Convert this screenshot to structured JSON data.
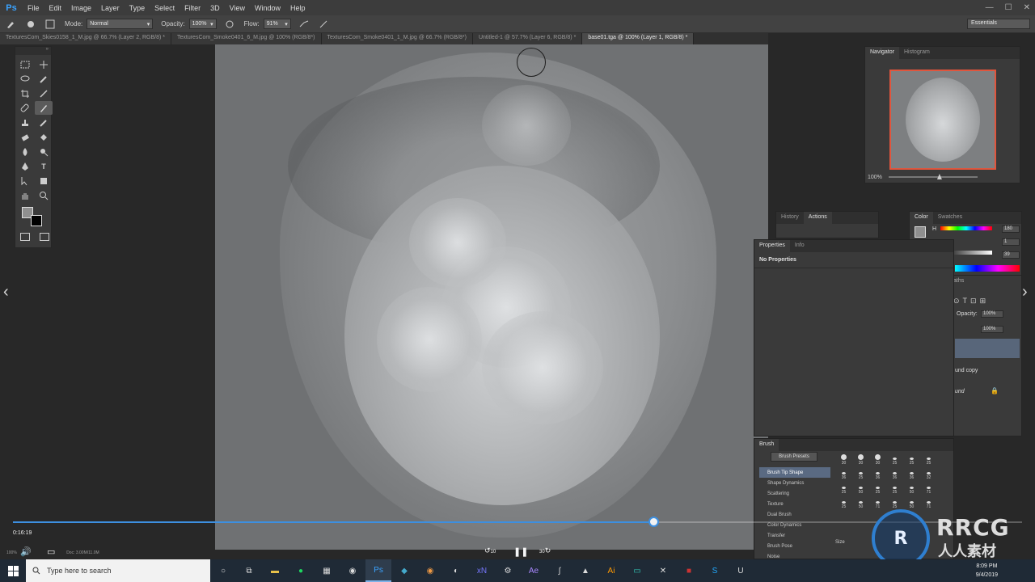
{
  "app": {
    "logo": "Ps"
  },
  "menu": [
    "File",
    "Edit",
    "Image",
    "Layer",
    "Type",
    "Select",
    "Filter",
    "3D",
    "View",
    "Window",
    "Help"
  ],
  "window_controls": [
    "—",
    "☐",
    "✕"
  ],
  "options": {
    "mode_label": "Mode:",
    "mode_value": "Normal",
    "opacity_label": "Opacity:",
    "opacity_value": "100%",
    "flow_label": "Flow:",
    "flow_value": "91%",
    "workspace": "Essentials"
  },
  "tabs": [
    {
      "label": "TexturesCom_Skies0158_1_M.jpg @ 66.7% (Layer 2, RGB/8) *",
      "active": false
    },
    {
      "label": "TexturesCom_Smoke0401_6_M.jpg @ 100% (RGB/8*)",
      "active": false
    },
    {
      "label": "TexturesCom_Smoke0401_1_M.jpg @ 66.7% (RGB/8*)",
      "active": false
    },
    {
      "label": "Untitled-1 @ 57.7% (Layer 6, RGB/8) *",
      "active": false
    },
    {
      "label": "base01.tga @ 100% (Layer 1, RGB/8) *",
      "active": true
    }
  ],
  "tool_icons": [
    "move-icon",
    "marquee-icon",
    "lasso-icon",
    "quick-select-icon",
    "crop-icon",
    "eyedropper-icon",
    "healing-icon",
    "brush-icon",
    "stamp-icon",
    "history-brush-icon",
    "eraser-icon",
    "bucket-icon",
    "blur-icon",
    "dodge-icon",
    "pen-icon",
    "type-icon",
    "path-select-icon",
    "shape-icon",
    "hand-icon",
    "zoom-icon"
  ],
  "navigator": {
    "tabs": [
      "Navigator",
      "Histogram"
    ],
    "zoom": "100%"
  },
  "history": {
    "tabs": [
      "History",
      "Actions"
    ]
  },
  "color": {
    "tabs": [
      "Color",
      "Swatches"
    ],
    "h_label": "H",
    "values": [
      "180",
      "1",
      "39"
    ],
    "units": [
      "°",
      "%",
      "%"
    ]
  },
  "layers": {
    "tab_partial": "aths",
    "opacity_label": "Opacity:",
    "opacity_value": "100%",
    "fill_value": "100%",
    "row1": "und copy",
    "row2": "und"
  },
  "properties": {
    "tabs": [
      "Properties",
      "Info"
    ],
    "body": "No Properties"
  },
  "brush": {
    "title": "Brush",
    "presets_button": "Brush Presets",
    "options": [
      "Brush Tip Shape",
      "Shape Dynamics",
      "Scattering",
      "Texture",
      "Dual Brush",
      "Color Dynamics",
      "Transfer",
      "Brush Pose",
      "Noise"
    ],
    "active_option": 0,
    "sizes": [
      "30",
      "30",
      "30",
      "25",
      "25",
      "25",
      "36",
      "25",
      "36",
      "36",
      "36",
      "32",
      "25",
      "50",
      "25",
      "25",
      "50",
      "71",
      "25",
      "50",
      "71",
      "25",
      "50",
      "71"
    ],
    "size_label": "Size"
  },
  "video": {
    "time": "0:16:19",
    "progress": 0.635,
    "rewind_label": "10",
    "forward_label": "30"
  },
  "status": {
    "zoom": "100%",
    "doc": "Doc: 3.00M/11.0M"
  },
  "watermark": {
    "logo_text": "R",
    "title": "RRCG",
    "subtitle": "人人素材"
  },
  "taskbar": {
    "search_placeholder": "Type here to search",
    "time": "8:09 PM",
    "date": "9/4/2019"
  }
}
